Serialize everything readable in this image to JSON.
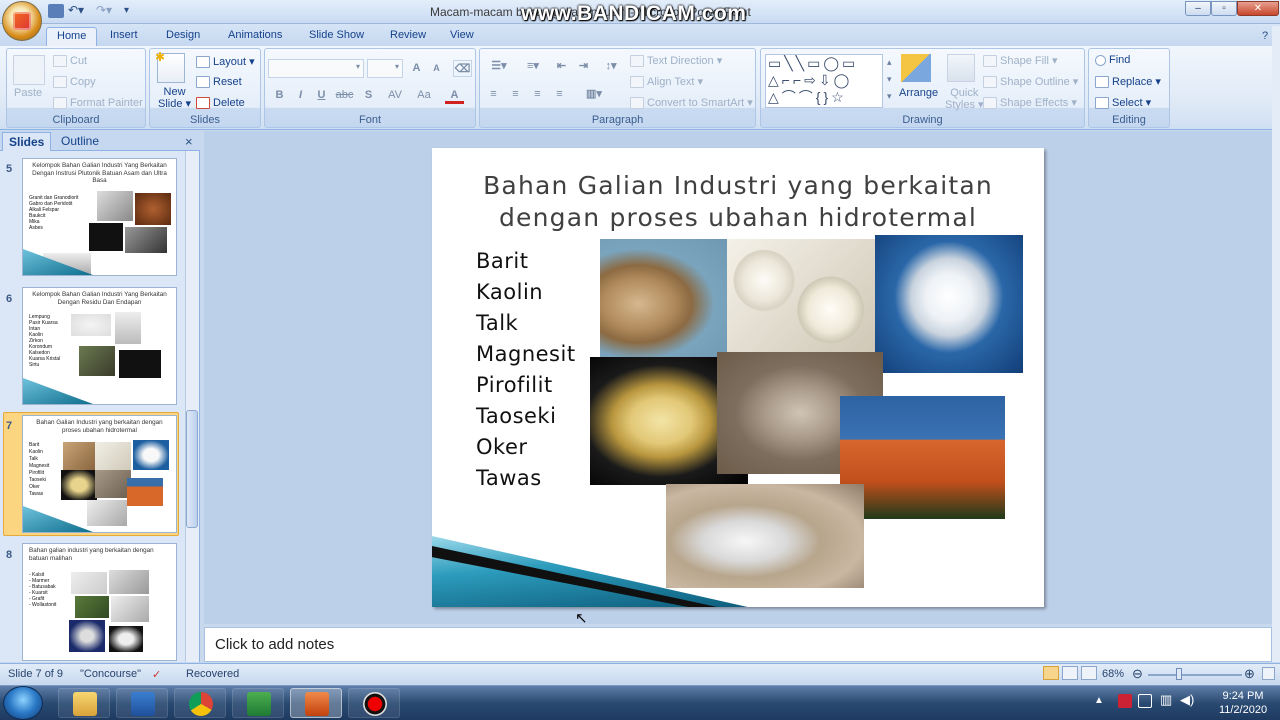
{
  "window": {
    "title": "Macam-macam bahan galian industri - Microsoft PowerPoint",
    "watermark": "www.BANDICAM.com",
    "min": "–",
    "max": "▫",
    "close": "✕"
  },
  "tabs": [
    "Home",
    "Insert",
    "Design",
    "Animations",
    "Slide Show",
    "Review",
    "View"
  ],
  "ribbon": {
    "clipboard": {
      "label": "Clipboard",
      "paste": "Paste",
      "cut": "Cut",
      "copy": "Copy",
      "format_painter": "Format Painter"
    },
    "slides": {
      "label": "Slides",
      "new_slide": "New",
      "new_slide2": "Slide",
      "layout": "Layout",
      "reset": "Reset",
      "delete": "Delete"
    },
    "font": {
      "label": "Font",
      "bold": "B",
      "italic": "I",
      "underline": "U",
      "strike": "abc",
      "shadow": "S",
      "spacing": "AV",
      "case": "Aa",
      "color": "A",
      "grow": "A",
      "shrink": "A"
    },
    "paragraph": {
      "label": "Paragraph",
      "text_direction": "Text Direction",
      "align_text": "Align Text",
      "smartart": "Convert to SmartArt"
    },
    "drawing": {
      "label": "Drawing",
      "arrange": "Arrange",
      "quick_styles": "Quick",
      "quick_styles2": "Styles",
      "shape_fill": "Shape Fill",
      "shape_outline": "Shape Outline",
      "shape_effects": "Shape Effects"
    },
    "editing": {
      "label": "Editing",
      "find": "Find",
      "replace": "Replace",
      "select": "Select"
    }
  },
  "pane": {
    "tabs": [
      "Slides",
      "Outline"
    ],
    "close": "×"
  },
  "thumbs": [
    {
      "num": "5",
      "title": "Kelompok Bahan Galian Industri Yang Berkaitan Dengan Instrusi Plutonik Batuan Asam dan Ultra Basa",
      "items": [
        "Granit dan Granodiorit",
        "Gabro dan Peridotit",
        "Alkali Felspar",
        "Baukcit",
        "Mika",
        "Asbes"
      ]
    },
    {
      "num": "6",
      "title": "Kelompok Bahan Galian Industri Yang Berkaitan Dengan Residu Dan Endapan",
      "items": [
        "Lempung",
        "Pasir Kuarsa",
        "Intan",
        "Kaolin",
        "Zirkon",
        "Korondum",
        "Kalsedon",
        "Kuarsa Kristal",
        "Sirtu"
      ]
    },
    {
      "num": "7",
      "title": "Bahan Galian Industri yang berkaitan dengan proses ubahan hidrotermal",
      "items": [
        "Barit",
        "Kaolin",
        "Talk",
        "Magnesit",
        "Pirofilit",
        "Taoseki",
        "Oker",
        "Tawas"
      ]
    },
    {
      "num": "8",
      "title": "Bahan galian industri yang berkaitan dengan batuan malihan",
      "items": [
        "- Kalsit",
        "- Marmer",
        "- Batusabak",
        "- Kuarsit",
        "- Grafit",
        "- Wollastonit"
      ]
    }
  ],
  "slide": {
    "title_line1": "Bahan Galian Industri yang berkaitan",
    "title_line2": "dengan proses ubahan hidrotermal",
    "bullets": [
      "Barit",
      "Kaolin",
      "Talk",
      "Magnesit",
      "Pirofilit",
      "Taoseki",
      "Oker",
      "Tawas"
    ]
  },
  "notes": {
    "placeholder": "Click to add notes"
  },
  "status": {
    "slide": "Slide 7 of 9",
    "theme": "\"Concourse\"",
    "recovered": "Recovered",
    "zoom": "68%"
  },
  "tray": {
    "time": "9:24 PM",
    "date": "11/2/2020"
  },
  "colors": {
    "accent": "#15428b",
    "selected_thumb": "#fbd580",
    "ribbon": "#dfe9f6"
  }
}
